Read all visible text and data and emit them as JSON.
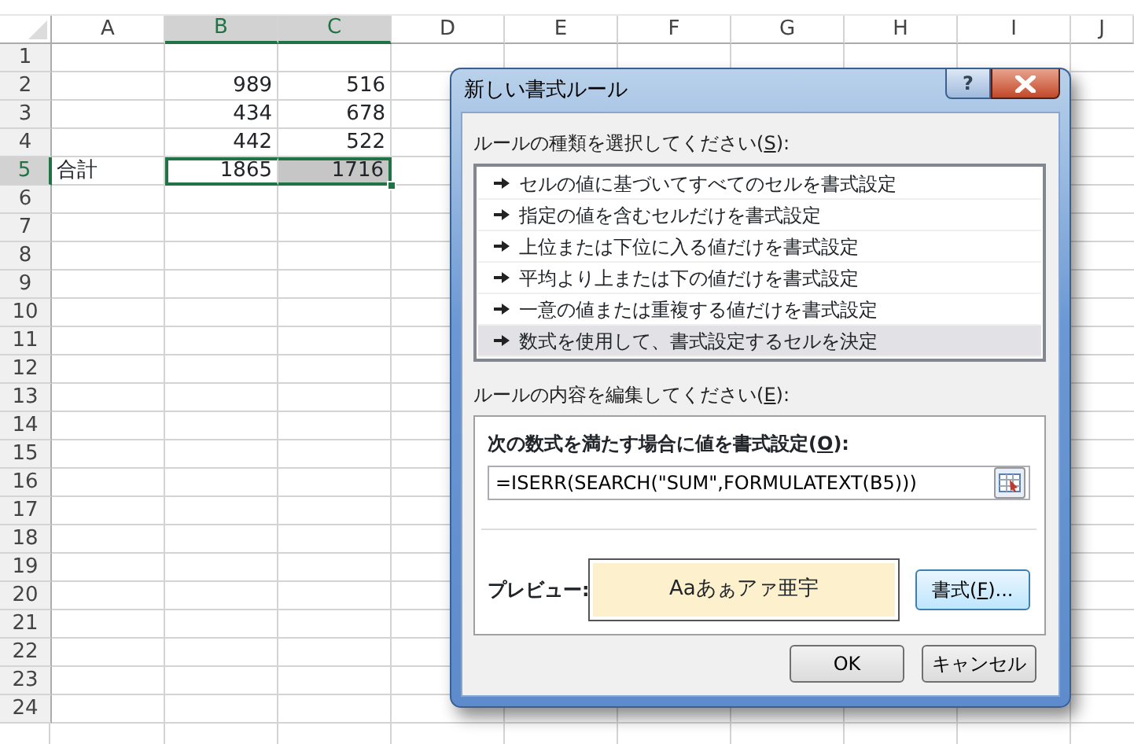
{
  "sheet": {
    "columns": [
      {
        "label": "A",
        "selected": false
      },
      {
        "label": "B",
        "selected": true
      },
      {
        "label": "C",
        "selected": true
      },
      {
        "label": "D",
        "selected": false
      },
      {
        "label": "E",
        "selected": false
      },
      {
        "label": "F",
        "selected": false
      },
      {
        "label": "G",
        "selected": false
      },
      {
        "label": "H",
        "selected": false
      },
      {
        "label": "I",
        "selected": false
      },
      {
        "label": "J",
        "selected": false
      }
    ],
    "rows": [
      {
        "label": "1",
        "selected": false
      },
      {
        "label": "2",
        "selected": false,
        "cells": {
          "b": {
            "text": "989",
            "selected": false,
            "active": false
          },
          "c": {
            "text": "516",
            "selected": false,
            "active": false
          }
        }
      },
      {
        "label": "3",
        "selected": false,
        "cells": {
          "b": {
            "text": "434",
            "selected": false,
            "active": false
          },
          "c": {
            "text": "678",
            "selected": false,
            "active": false
          }
        }
      },
      {
        "label": "4",
        "selected": false,
        "cells": {
          "b": {
            "text": "442",
            "selected": false,
            "active": false
          },
          "c": {
            "text": "522",
            "selected": false,
            "active": false
          }
        }
      },
      {
        "label": "5",
        "selected": true,
        "cells": {
          "a": {
            "text": "合計",
            "selected": false,
            "active": false
          },
          "b": {
            "text": "1865",
            "selected": true,
            "active": true
          },
          "c": {
            "text": "1716",
            "selected": true,
            "active": false
          }
        }
      },
      {
        "label": "6",
        "selected": false
      },
      {
        "label": "7",
        "selected": false
      },
      {
        "label": "8",
        "selected": false
      },
      {
        "label": "9",
        "selected": false
      },
      {
        "label": "10",
        "selected": false
      },
      {
        "label": "11",
        "selected": false
      },
      {
        "label": "12",
        "selected": false
      },
      {
        "label": "13",
        "selected": false
      },
      {
        "label": "14",
        "selected": false
      },
      {
        "label": "15",
        "selected": false
      },
      {
        "label": "16",
        "selected": false
      },
      {
        "label": "17",
        "selected": false
      },
      {
        "label": "18",
        "selected": false
      },
      {
        "label": "19",
        "selected": false
      },
      {
        "label": "20",
        "selected": false
      },
      {
        "label": "21",
        "selected": false
      },
      {
        "label": "22",
        "selected": false
      },
      {
        "label": "23",
        "selected": false
      },
      {
        "label": "24",
        "selected": false
      }
    ]
  },
  "dialog": {
    "title": "新しい書式ルール",
    "help_button": "?",
    "rule_type_label": {
      "before": "ルールの種類を選択してください(",
      "access_key": "S",
      "after": "):"
    },
    "rule_types": [
      {
        "text": "セルの値に基づいてすべてのセルを書式設定",
        "selected": false
      },
      {
        "text": "指定の値を含むセルだけを書式設定",
        "selected": false
      },
      {
        "text": "上位または下位に入る値だけを書式設定",
        "selected": false
      },
      {
        "text": "平均より上または下の値だけを書式設定",
        "selected": false
      },
      {
        "text": "一意の値または重複する値だけを書式設定",
        "selected": false
      },
      {
        "text": "数式を使用して、書式設定するセルを決定",
        "selected": true
      }
    ],
    "edit_label": {
      "before": "ルールの内容を編集してください(",
      "access_key": "E",
      "after": "):"
    },
    "formula_label": {
      "before": "次の数式を満たす場合に値を書式設定(",
      "access_key": "O",
      "after": "):"
    },
    "formula": "=ISERR(SEARCH(\"SUM\",FORMULATEXT(B5)))",
    "preview_label": "プレビュー:",
    "preview_text": "Aaあぁアァ亜宇",
    "format_button": {
      "before": "書式(",
      "access_key": "F",
      "after": ")..."
    },
    "buttons": [
      "OK",
      "キャンセル"
    ]
  }
}
